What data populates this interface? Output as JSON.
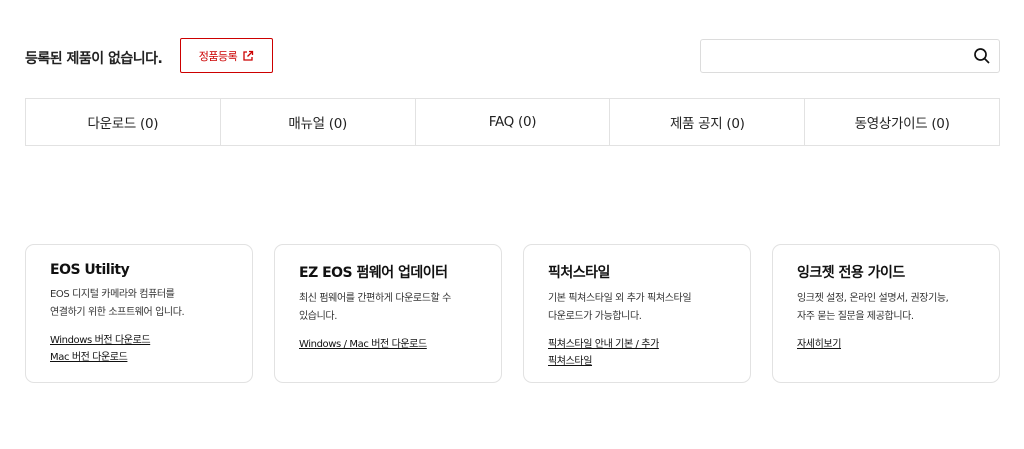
{
  "registration": {
    "status_text": "등록된 제품이 없습니다.",
    "register_button_label": "정품등록"
  },
  "search": {
    "value": "",
    "placeholder": ""
  },
  "tabs": [
    {
      "label": "다운로드 (0)"
    },
    {
      "label": "매뉴얼 (0)"
    },
    {
      "label": "FAQ (0)"
    },
    {
      "label": "제품 공지 (0)"
    },
    {
      "label": "동영상가이드 (0)"
    }
  ],
  "cards": [
    {
      "title": "EOS Utility",
      "desc": [
        "EOS 디지털 카메라와 컴퓨터를",
        "연결하기 위한 소프트웨어 입니다."
      ],
      "links": [
        "Windows 버전 다운로드",
        "Mac 버전 다운로드"
      ]
    },
    {
      "title": "EZ EOS 펌웨어 업데이터",
      "desc": [
        "최신 펌웨어를 간편하게 다운로드할 수",
        "있습니다."
      ],
      "links": [
        "Windows / Mac 버전 다운로드"
      ]
    },
    {
      "title": "픽처스타일",
      "desc": [
        "기본 픽쳐스타일 외 추가 픽쳐스타일",
        "다운로드가 가능합니다."
      ],
      "links": [
        "픽쳐스타일 안내 기본 / 추가",
        "픽쳐스타일"
      ]
    },
    {
      "title": "잉크젯 전용 가이드",
      "desc": [
        "잉크젯 설정, 온라인 설명서, 권장기능,",
        "자주 묻는 질문을 제공합니다."
      ],
      "links": [
        "자세히보기"
      ]
    }
  ],
  "colors": {
    "accent": "#cc0000",
    "border": "#e2e2e2",
    "text": "#111111"
  },
  "icons": {
    "register": "external-link-icon",
    "search": "search-icon"
  }
}
